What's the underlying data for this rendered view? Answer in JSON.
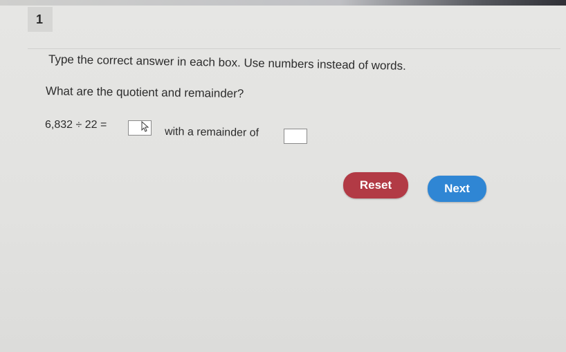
{
  "question": {
    "number": "1",
    "instruction": "Type the correct answer in each box. Use numbers instead of words.",
    "prompt": "What are the quotient and remainder?",
    "equation_left": "6,832 ÷ 22 =",
    "connector": "with a remainder of",
    "quotient_value": "",
    "remainder_value": ""
  },
  "buttons": {
    "reset_label": "Reset",
    "next_label": "Next"
  },
  "colors": {
    "reset": "#b23a45",
    "next": "#2f86d4"
  },
  "icons": {
    "cursor": "pointer-cursor-icon"
  }
}
